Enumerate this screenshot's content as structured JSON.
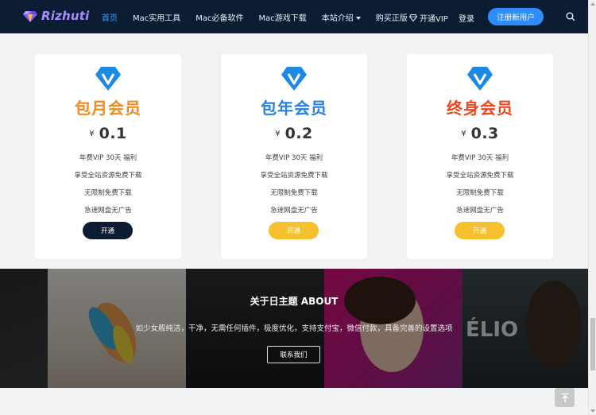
{
  "header": {
    "logo_text": "Rizhuti",
    "nav": [
      {
        "label": "首页",
        "active": true
      },
      {
        "label": "Mac实用工具"
      },
      {
        "label": "Mac必备软件"
      },
      {
        "label": "Mac游戏下载"
      },
      {
        "label": "本站介绍",
        "dropdown": true
      },
      {
        "label": "购买正版"
      }
    ],
    "vip_label": "开通VIP",
    "login_label": "登录",
    "register_label": "注册新用户"
  },
  "plans": [
    {
      "title": "包月会员",
      "title_color": "#f08a1e",
      "currency": "¥",
      "price": "0.1",
      "features": [
        "年费VIP 30天 福利",
        "享受全站资源免费下载",
        "无限制免费下载",
        "急速网盘无广告"
      ],
      "button_label": "开通",
      "button_style": "dark"
    },
    {
      "title": "包年会员",
      "title_color": "#2680e0",
      "currency": "¥",
      "price": "0.2",
      "features": [
        "年费VIP 30天 福利",
        "享受全站资源免费下载",
        "无限制免费下载",
        "急速网盘无广告"
      ],
      "button_label": "开通",
      "button_style": "gold"
    },
    {
      "title": "终身会员",
      "title_color": "#f0451c",
      "currency": "¥",
      "price": "0.3",
      "features": [
        "年费VIP 30天 福利",
        "享受全站资源免费下载",
        "无限制免费下载",
        "急速网盘无广告"
      ],
      "button_label": "开通",
      "button_style": "gold"
    }
  ],
  "about": {
    "title": "关于日主题 ABOUT",
    "description": "如少女般纯洁，干净，无需任何插件，极度优化，支持支付宝，微信付款，具备完善的设置选项",
    "button_label": "联系我们",
    "poster_text": "ÉLIO"
  },
  "colors": {
    "header_bg": "#0c1d33",
    "accent": "#2f8cff",
    "vip_blue": "#1e88e5",
    "gold": "#f5c12e",
    "dark_button": "#0c1d33"
  },
  "icons": {
    "logo": "diamond-logo-icon",
    "vip": "diamond-icon",
    "search": "search-icon",
    "plan": "vip-badge-icon",
    "back_top": "arrow-up-icon"
  }
}
